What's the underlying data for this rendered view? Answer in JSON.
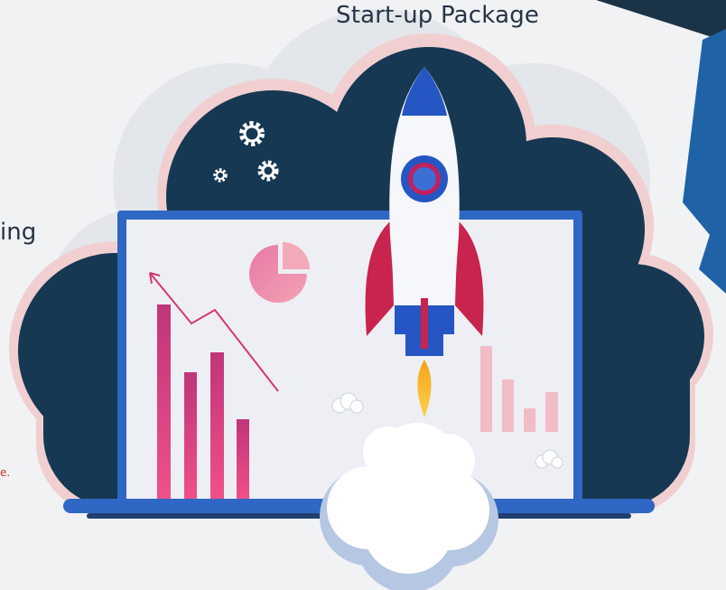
{
  "slide": {
    "title": "Start-up Package",
    "cropped_left_word": "ing",
    "cropped_red_text": "e."
  },
  "colors": {
    "background": "#f1f2f4",
    "cloud_dark": "#163852",
    "corner_navy": "#1b3347",
    "corner_blue": "#1f63a6",
    "screen_frame": "#2f67c4",
    "screen_bg": "#eeeff4",
    "bar_pink": "#e0407a",
    "rocket_white": "#f6f7fb",
    "rocket_blue": "#2556c4",
    "rocket_crimson": "#c8244e"
  },
  "icons": [
    "gear-icon",
    "gear-icon",
    "gear-icon",
    "pie-chart-icon",
    "rocket-icon",
    "trend-arrow-icon"
  ]
}
